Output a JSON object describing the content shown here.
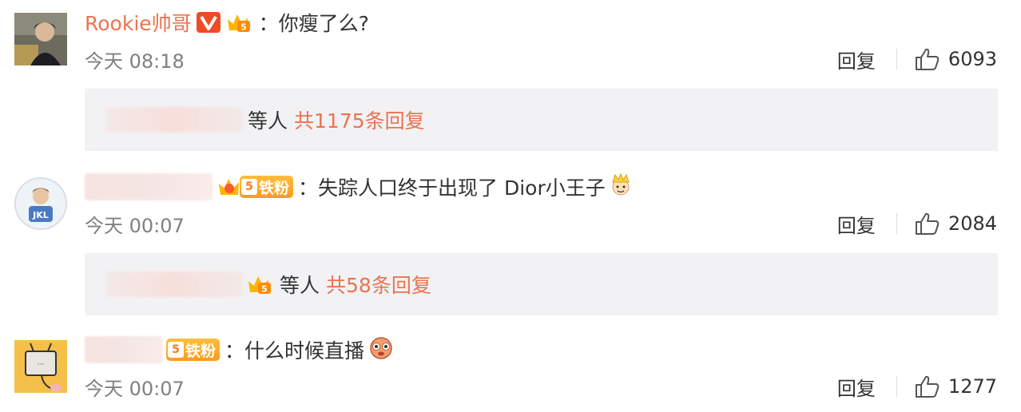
{
  "colors": {
    "accent": "#eb7350",
    "time": "#808080",
    "reply_bg": "#f2f2f5",
    "badge": "#ff9a1a"
  },
  "comments": [
    {
      "username": "Rookie帅哥",
      "verified_icon": "v-verified-icon",
      "badge_icon": "crown-fan-icon",
      "colon": "：",
      "text": "你瘦了么?",
      "time": "今天 08:18",
      "reply_label": "回复",
      "likes": "6093",
      "replies": {
        "suffix": "等人",
        "count_label": "共1175条回复"
      }
    },
    {
      "username": "",
      "badge_icon": "crown-fan-icon",
      "fan_badge_digit": "5",
      "fan_badge_label": "铁粉",
      "colon": "：",
      "text": "失踪人口终于出现了 Dior小王子",
      "emoji": "prince-crown-emoji",
      "time": "今天 00:07",
      "reply_label": "回复",
      "likes": "2084",
      "replies": {
        "suffix": "等人",
        "count_label": "共58条回复"
      }
    },
    {
      "username": "",
      "fan_badge_digit": "5",
      "fan_badge_label": "铁粉",
      "colon": "：",
      "text": "什么时候直播",
      "emoji": "shy-face-emoji",
      "time": "今天 00:07",
      "reply_label": "回复",
      "likes": "1277"
    }
  ]
}
